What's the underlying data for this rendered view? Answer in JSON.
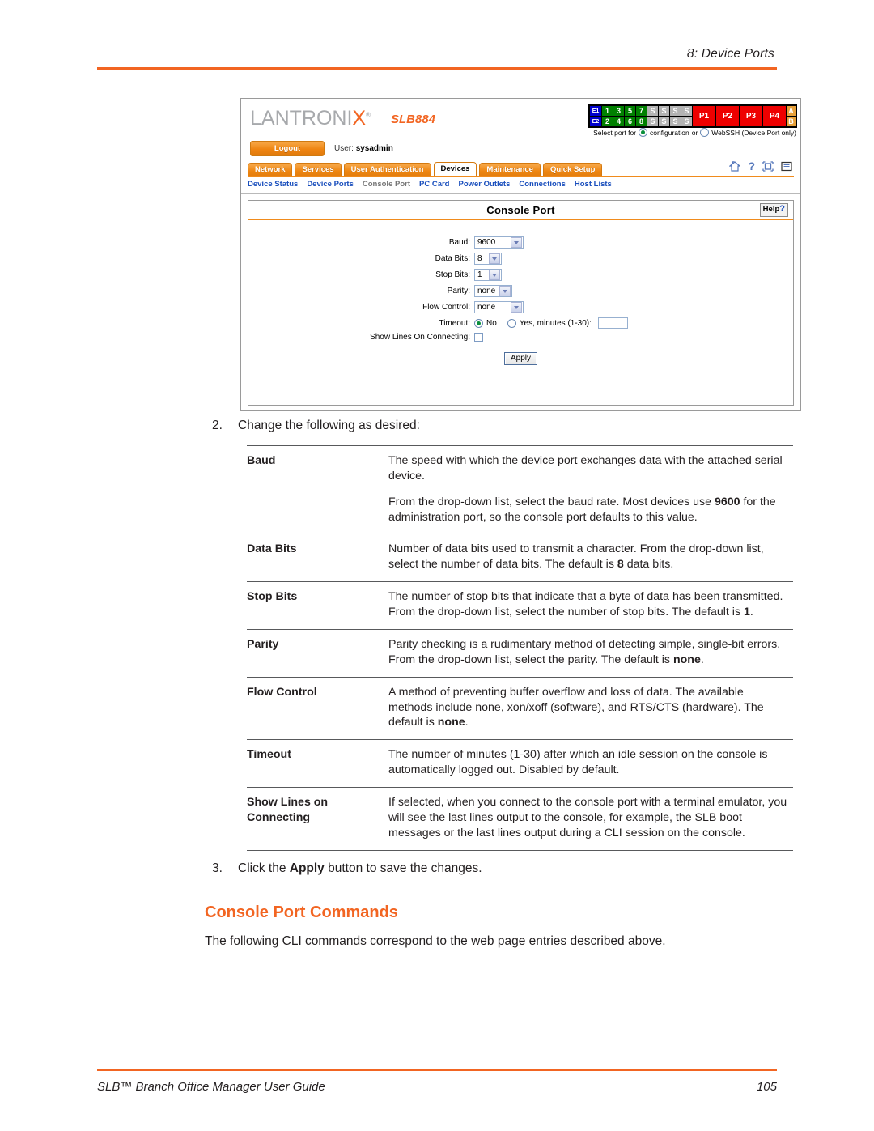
{
  "page": {
    "running_header": "8: Device Ports",
    "footer_title": "SLB™ Branch Office Manager User Guide",
    "footer_page_number": "105",
    "accent_color": "#f26522",
    "text_color": "#231f20"
  },
  "screenshot": {
    "brand": {
      "logo_text_a": "LANTRONI",
      "logo_text_x": "X",
      "logo_reg": "®",
      "model": "SLB884"
    },
    "session": {
      "logout_label": "Logout",
      "user_label": "User:",
      "user_name": "sysadmin"
    },
    "port_matrix": {
      "ethernet": [
        "E1",
        "E2"
      ],
      "device_ports_row1": [
        "1",
        "3",
        "5",
        "7"
      ],
      "device_ports_row2": [
        "2",
        "4",
        "6",
        "8"
      ],
      "s_row1": [
        "S",
        "S",
        "S",
        "S"
      ],
      "s_row2": [
        "S",
        "S",
        "S",
        "S"
      ],
      "power": [
        "P1",
        "P2",
        "P3",
        "P4"
      ],
      "ab": [
        "A",
        "B"
      ],
      "colors": {
        "ethernet": "#0000cd",
        "device": "#008000",
        "s": "#b3b3b3",
        "power": "#ee0000",
        "ab": "#e8a13a"
      }
    },
    "select_port": {
      "prefix": "Select port for",
      "option_configuration": "configuration",
      "conjunction": "or",
      "option_webssh": "WebSSH (Device Port only)",
      "selected": "configuration"
    },
    "tabs": [
      {
        "label": "Network",
        "active": false
      },
      {
        "label": "Services",
        "active": false
      },
      {
        "label": "User Authentication",
        "active": false
      },
      {
        "label": "Devices",
        "active": true
      },
      {
        "label": "Maintenance",
        "active": false
      },
      {
        "label": "Quick Setup",
        "active": false
      }
    ],
    "tool_icons": [
      "home-icon",
      "help-question-icon",
      "expand-icon",
      "list-icon"
    ],
    "subnav": [
      {
        "label": "Device Status",
        "current": false
      },
      {
        "label": "Device Ports",
        "current": false
      },
      {
        "label": "Console Port",
        "current": true
      },
      {
        "label": "PC Card",
        "current": false
      },
      {
        "label": "Power Outlets",
        "current": false
      },
      {
        "label": "Connections",
        "current": false
      },
      {
        "label": "Host Lists",
        "current": false
      }
    ],
    "panel": {
      "title": "Console Port",
      "help_label": "Help",
      "help_glyph": "?"
    },
    "form": {
      "baud": {
        "label": "Baud:",
        "value": "9600"
      },
      "data_bits": {
        "label": "Data Bits:",
        "value": "8"
      },
      "stop_bits": {
        "label": "Stop Bits:",
        "value": "1"
      },
      "parity": {
        "label": "Parity:",
        "value": "none"
      },
      "flow_control": {
        "label": "Flow Control:",
        "value": "none"
      },
      "timeout": {
        "label": "Timeout:",
        "option_no": "No",
        "option_yes": "Yes, minutes (1-30):",
        "selected": "No",
        "minutes_value": ""
      },
      "show_lines": {
        "label": "Show Lines On Connecting:",
        "checked": false
      },
      "apply_label": "Apply"
    }
  },
  "doc": {
    "step2": {
      "number": "2.",
      "text": "Change the following as desired:"
    },
    "step3": {
      "number": "3.",
      "prefix": "Click the ",
      "bold": "Apply",
      "suffix": " button to save the changes."
    },
    "params": [
      {
        "name": "Baud",
        "paragraphs": [
          "The speed with which the device port exchanges data with the attached serial device.",
          "From the drop-down list, select the baud rate. Most devices use 9600 for the administration port, so the console port defaults to this value."
        ]
      },
      {
        "name": "Data Bits",
        "paragraphs": [
          "Number of data bits used to transmit a character. From the drop-down list, select the number of data bits. The default is 8 data bits."
        ]
      },
      {
        "name": "Stop Bits",
        "paragraphs": [
          "The number of stop bits that indicate that a byte of data has been transmitted. From the drop-down list, select the number of stop bits. The default is 1."
        ]
      },
      {
        "name": "Parity",
        "paragraphs": [
          "Parity checking is a rudimentary method of detecting simple, single-bit errors. From the drop-down list, select the parity. The default is none."
        ]
      },
      {
        "name": "Flow Control",
        "paragraphs": [
          "A method of preventing buffer overflow and loss of data. The available methods include none, xon/xoff (software), and RTS/CTS (hardware). The default is none."
        ]
      },
      {
        "name": "Timeout",
        "paragraphs": [
          "The number of minutes (1-30) after which an idle session on the console is automatically logged out. Disabled by default."
        ]
      },
      {
        "name": "Show Lines on Connecting",
        "paragraphs": [
          "If selected, when you connect to the console port with a terminal emulator, you will see the last lines output to the console, for example, the SLB boot messages or the last lines output during a CLI session on the console."
        ]
      }
    ],
    "section_heading": "Console Port Commands",
    "section_para": "The following CLI commands correspond to the web page entries described above."
  }
}
